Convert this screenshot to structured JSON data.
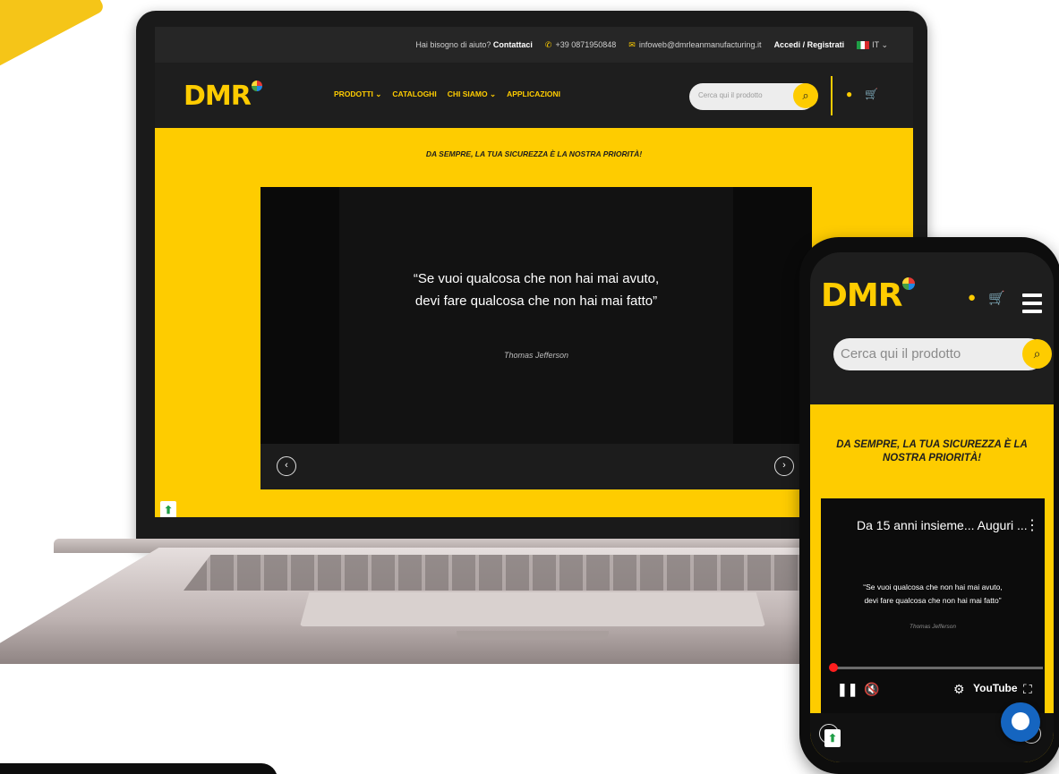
{
  "laptop": {
    "topbar": {
      "help_text": "Hai bisogno di aiuto?",
      "contact_label": "Contattaci",
      "phone": "+39 0871950848",
      "email": "infoweb@dmrleanmanufacturing.it",
      "login_label": "Accedi / Registrati",
      "language": "IT"
    },
    "nav": {
      "logo": "DMR",
      "menu": [
        "PRODOTTI",
        "CATALOGHI",
        "CHI SIAMO",
        "APPLICAZIONI"
      ],
      "search_placeholder": "Cerca qui il prodotto"
    },
    "tagline": "DA SEMPRE, LA TUA SICUREZZA È LA NOSTRA PRIORITÀ!",
    "video": {
      "quote_line1": "“Se vuoi qualcosa che non hai mai avuto,",
      "quote_line2": "devi fare qualcosa che non hai mai fatto”",
      "author": "Thomas Jefferson"
    }
  },
  "phone": {
    "logo": "DMR",
    "search_placeholder": "Cerca qui il prodotto",
    "tagline": "DA SEMPRE, LA TUA SICUREZZA È LA NOSTRA PRIORITÀ!",
    "video": {
      "title": "Da 15 anni insieme... Auguri ...",
      "quote_line1": "“Se vuoi qualcosa che non hai mai avuto,",
      "quote_line2": "devi fare qualcosa che non hai mai fatto”",
      "author": "Thomas Jefferson",
      "youtube_label": "YouTube",
      "progress": 0.01
    }
  },
  "colors": {
    "brand_yellow": "#fecc00",
    "dark": "#1e1e1e"
  }
}
